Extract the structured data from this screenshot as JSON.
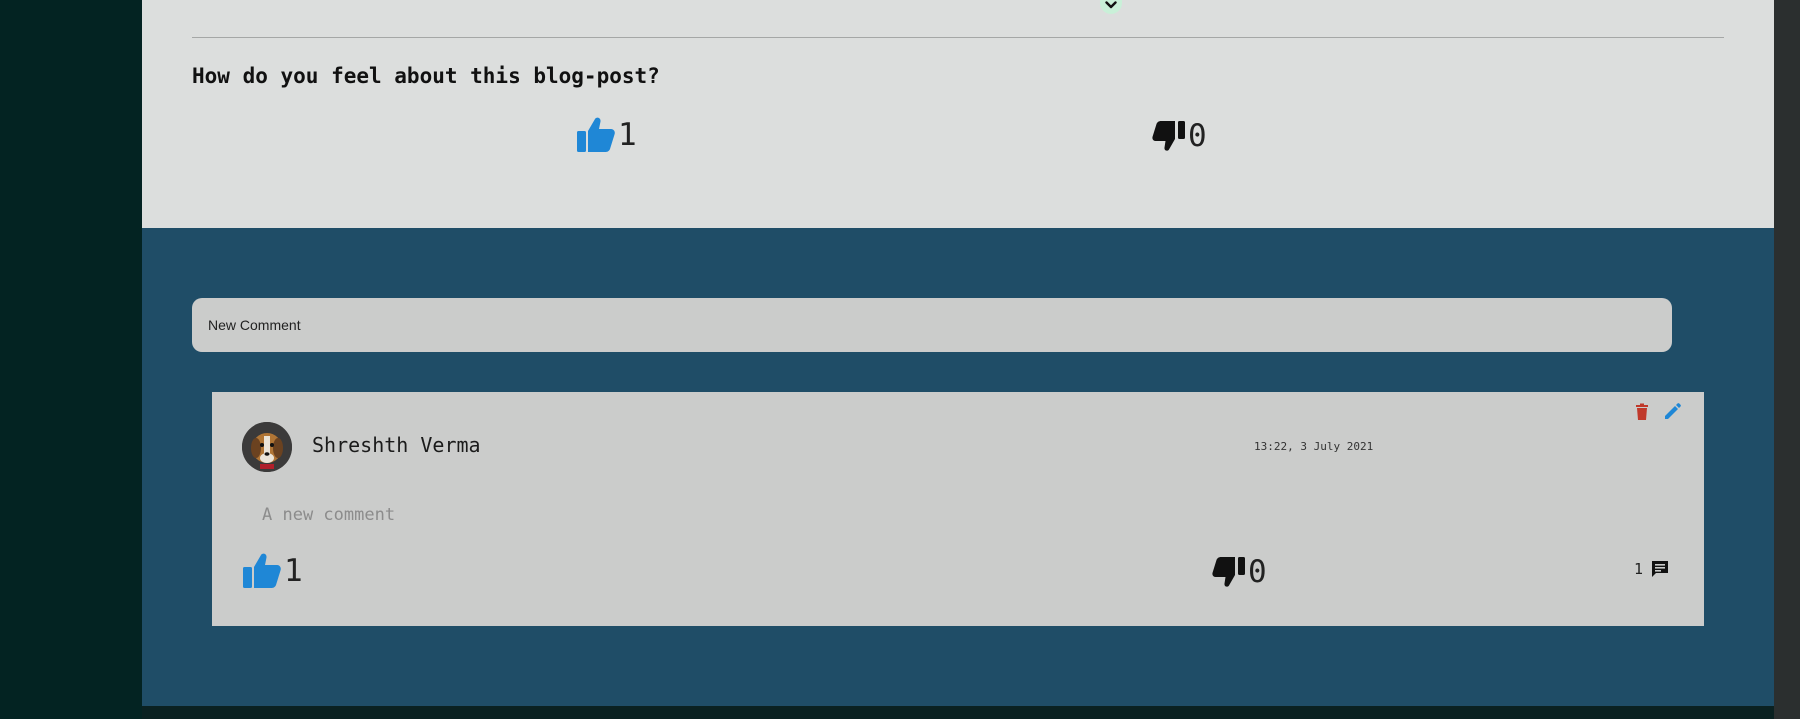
{
  "post_feedback": {
    "question": "How do you feel about this blog-post?",
    "likes": "1",
    "dislikes": "0"
  },
  "new_comment": {
    "placeholder": "New Comment"
  },
  "comment": {
    "author": "Shreshth Verma",
    "timestamp": "13:22, 3 July 2021",
    "body": "A new comment",
    "likes": "1",
    "dislikes": "0",
    "replies": "1"
  },
  "colors": {
    "like_accent": "#1f87d6",
    "dislike": "#111111",
    "delete": "#c0392b",
    "edit": "#1f87d6",
    "comments_panel": "#1f4d67",
    "post_panel": "#dcdedd"
  }
}
